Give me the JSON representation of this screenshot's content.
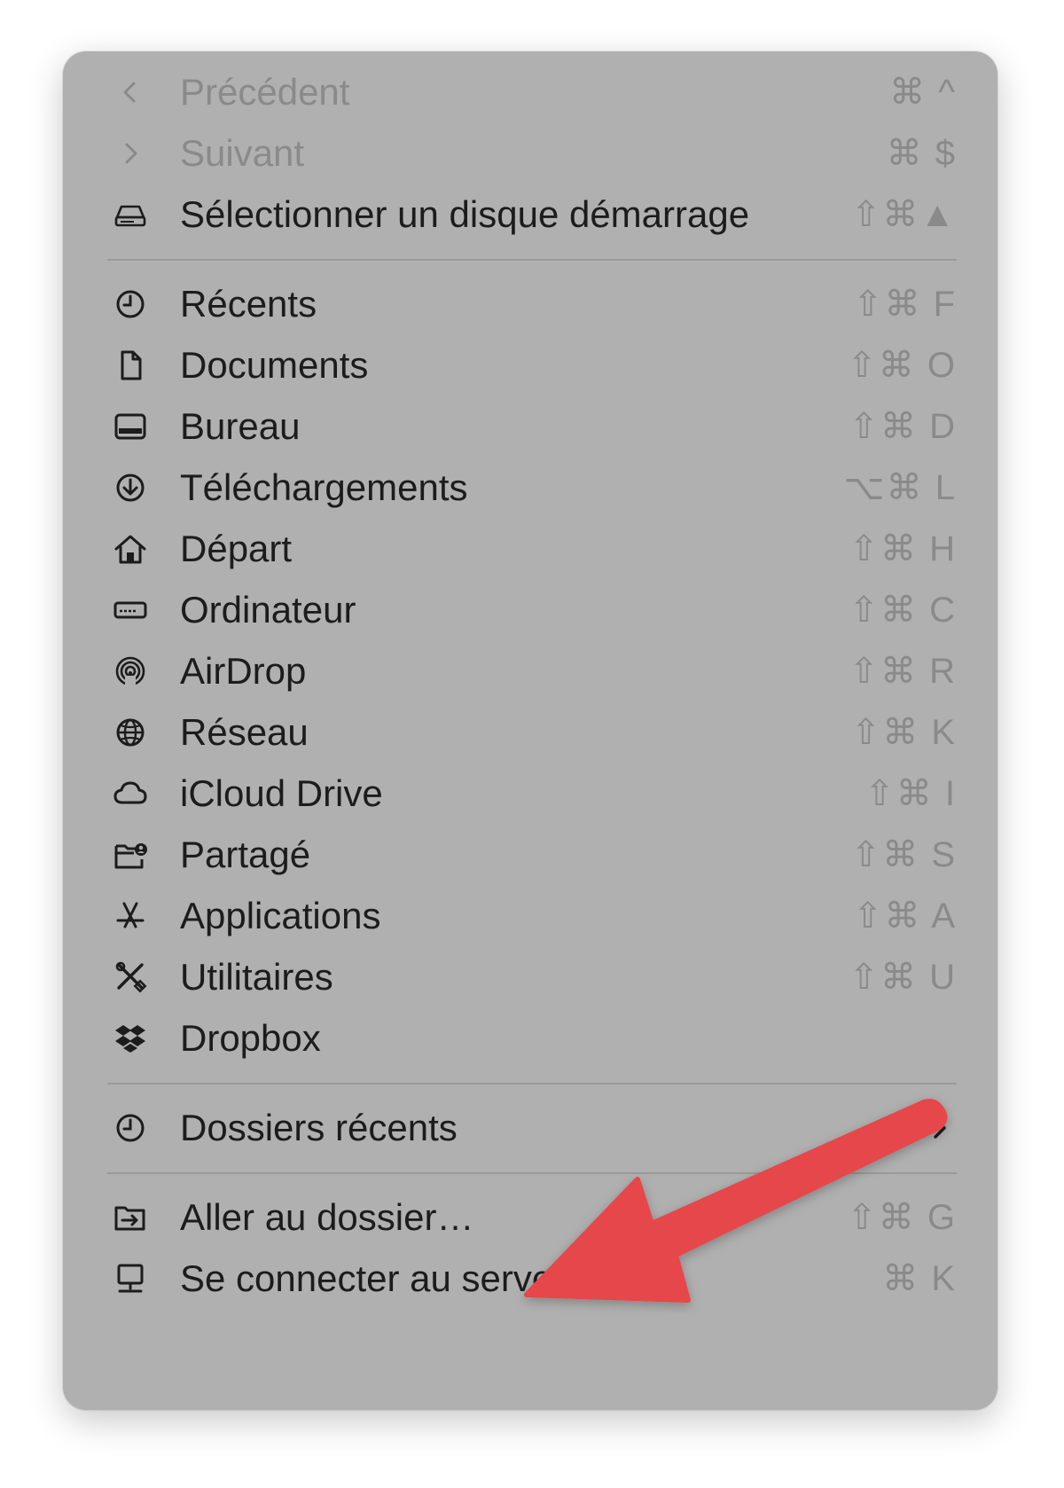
{
  "menu": {
    "items": [
      {
        "label": "Précédent",
        "shortcut": "⌘ ^",
        "icon": "chevron-left-icon",
        "disabled": true
      },
      {
        "label": "Suivant",
        "shortcut": "⌘ $",
        "icon": "chevron-right-icon",
        "disabled": true
      },
      {
        "label": "Sélectionner un disque démarrage",
        "shortcut": "⇧⌘▲",
        "icon": "drive-icon",
        "disabled": false
      },
      {
        "label": "Récents",
        "shortcut": "⇧⌘ F",
        "icon": "clock-icon"
      },
      {
        "label": "Documents",
        "shortcut": "⇧⌘ O",
        "icon": "document-icon"
      },
      {
        "label": "Bureau",
        "shortcut": "⇧⌘ D",
        "icon": "desktop-icon"
      },
      {
        "label": "Téléchargements",
        "shortcut": "⌥⌘ L",
        "icon": "download-icon"
      },
      {
        "label": "Départ",
        "shortcut": "⇧⌘ H",
        "icon": "home-icon"
      },
      {
        "label": "Ordinateur",
        "shortcut": "⇧⌘ C",
        "icon": "computer-icon"
      },
      {
        "label": "AirDrop",
        "shortcut": "⇧⌘ R",
        "icon": "airdrop-icon"
      },
      {
        "label": "Réseau",
        "shortcut": "⇧⌘ K",
        "icon": "globe-icon"
      },
      {
        "label": "iCloud Drive",
        "shortcut": "⇧⌘ I",
        "icon": "cloud-icon"
      },
      {
        "label": "Partagé",
        "shortcut": "⇧⌘ S",
        "icon": "shared-folder-icon"
      },
      {
        "label": "Applications",
        "shortcut": "⇧⌘ A",
        "icon": "applications-icon"
      },
      {
        "label": "Utilitaires",
        "shortcut": "⇧⌘ U",
        "icon": "tools-icon"
      },
      {
        "label": "Dropbox",
        "shortcut": "",
        "icon": "dropbox-icon"
      },
      {
        "label": "Dossiers récents",
        "shortcut": "",
        "icon": "clock-icon",
        "submenu": true
      },
      {
        "label": "Aller au dossier…",
        "shortcut": "⇧⌘ G",
        "icon": "go-to-folder-icon"
      },
      {
        "label": "Se connecter au serveur…",
        "shortcut": "⌘ K",
        "icon": "server-icon"
      }
    ]
  },
  "annotation": {
    "arrow_color": "#e5474b"
  }
}
